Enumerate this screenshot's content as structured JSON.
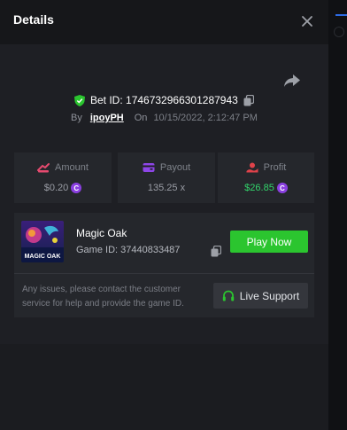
{
  "header": {
    "title": "Details"
  },
  "bet": {
    "id_text": "Bet ID: 1746732966301287943",
    "by_label": "By",
    "username": "ipoyPH",
    "on_label": "On",
    "date": "10/15/2022, 2:12:47 PM"
  },
  "stats": {
    "amount": {
      "label": "Amount",
      "value": "$0.20",
      "coin": "C"
    },
    "payout": {
      "label": "Payout",
      "value": "135.25 x"
    },
    "profit": {
      "label": "Profit",
      "value": "$26.85",
      "coin": "C"
    }
  },
  "game": {
    "name": "Magic Oak",
    "id_text": "Game ID: 37440833487",
    "thumb_caption": "MAGIC OAK",
    "play_label": "Play Now"
  },
  "support": {
    "help_text": "Any issues, please contact the customer service for help and provide the game ID.",
    "button_label": "Live Support"
  },
  "colors": {
    "accent_green": "#2bc52f",
    "profit_green": "#32d46b",
    "coin_purple": "#8a3fe0",
    "amount_pink": "#e64a6f",
    "payout_purple": "#8e46e8",
    "profit_red": "#e0424a"
  },
  "icons": [
    "close-icon",
    "share-icon",
    "shield-check-icon",
    "copy-icon",
    "amount-icon",
    "payout-icon",
    "profit-icon",
    "coin-icon",
    "headset-icon"
  ]
}
